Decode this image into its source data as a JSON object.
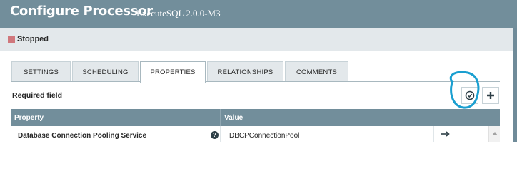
{
  "header": {
    "title": "Configure Processor",
    "subtitle": "ExecuteSQL 2.0.0-M3",
    "bg_color": "#728e9b"
  },
  "status": {
    "label": "Stopped",
    "icon": "stopped-square-icon",
    "color": "#d0777c"
  },
  "tabs": [
    {
      "label": "SETTINGS",
      "active": false
    },
    {
      "label": "SCHEDULING",
      "active": false
    },
    {
      "label": "PROPERTIES",
      "active": true
    },
    {
      "label": "RELATIONSHIPS",
      "active": false
    },
    {
      "label": "COMMENTS",
      "active": false
    }
  ],
  "properties_panel": {
    "required_label": "Required field",
    "verify_button_icon": "check-circle-icon",
    "add_button_icon": "plus-icon",
    "annotation_color": "#1a9fd0"
  },
  "table": {
    "columns": [
      "Property",
      "Value"
    ],
    "rows": [
      {
        "property": "Database Connection Pooling Service",
        "help_icon": "question-circle-icon",
        "help_glyph": "?",
        "value": "DBCPConnectionPool",
        "action_icon": "arrow-right-icon"
      }
    ]
  }
}
